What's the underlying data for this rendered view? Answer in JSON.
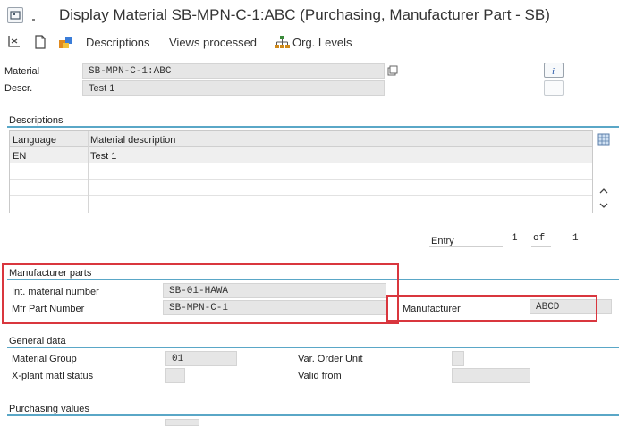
{
  "window": {
    "title": "Display Material SB-MPN-C-1:ABC (Purchasing, Manufacturer Part - SB)"
  },
  "toolbar": {
    "descriptions": "Descriptions",
    "views_processed": "Views processed",
    "org_levels": "Org. Levels"
  },
  "header": {
    "material_label": "Material",
    "material_value": "SB-MPN-C-1:ABC",
    "descr_label": "Descr.",
    "descr_value": "Test 1",
    "info_btn": "i"
  },
  "descriptions": {
    "section_title": "Descriptions",
    "col_language": "Language",
    "col_material_description": "Material description",
    "rows": [
      {
        "language": "EN",
        "description": "Test 1"
      }
    ],
    "entry_label": "Entry",
    "entry_current": "1",
    "entry_of": "of",
    "entry_total": "1"
  },
  "manufacturer_parts": {
    "section_title": "Manufacturer parts",
    "int_material_label": "Int. material number",
    "int_material_value": "SB-01-HAWA",
    "mfr_part_label": "Mfr Part Number",
    "mfr_part_value": "SB-MPN-C-1",
    "manufacturer_label": "Manufacturer",
    "manufacturer_value": "ABCD"
  },
  "general_data": {
    "section_title": "General data",
    "material_group_label": "Material Group",
    "material_group_value": "01",
    "xplant_label": "X-plant matl status",
    "var_order_unit_label": "Var. Order Unit",
    "valid_from_label": "Valid from"
  },
  "purchasing_values": {
    "section_title": "Purchasing values"
  },
  "colors": {
    "section_line": "#5aa7c7",
    "highlight_box": "#d9363e",
    "field_bg": "#e6e6e6"
  }
}
